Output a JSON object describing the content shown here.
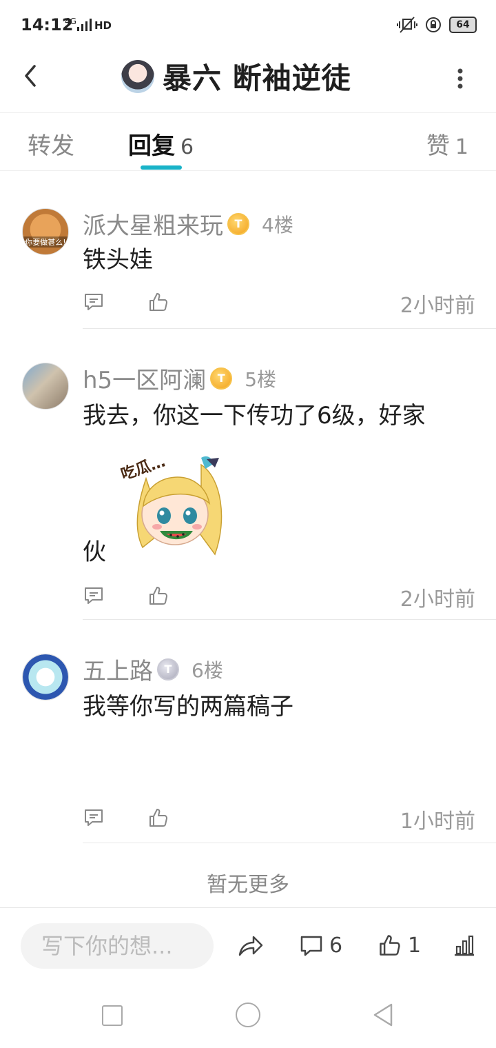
{
  "status_bar": {
    "time": "14:12",
    "network": "4G",
    "hd": "HD",
    "battery": "64"
  },
  "header": {
    "title": "暴六 断袖逆徒"
  },
  "tabs": [
    {
      "label": "转发",
      "count": ""
    },
    {
      "label": "回复",
      "count": "6"
    },
    {
      "label": "赞",
      "count": "1"
    }
  ],
  "comments": [
    {
      "name": "派大星粗来玩",
      "floor": "4楼",
      "avatar_caption": "你要做甚么!",
      "badge": "T",
      "text": "铁头娃",
      "time": "2小时前"
    },
    {
      "name": "h5一区阿澜",
      "floor": "5楼",
      "badge": "T",
      "text_line1": "我去，你这一下传功了6级，好家",
      "text_line2": "伙",
      "sticker_text": "吃瓜…",
      "time": "2小时前"
    },
    {
      "name": "五上路",
      "floor": "6楼",
      "badge": "T",
      "text": "我等你写的两篇稿子",
      "time": "1小时前"
    }
  ],
  "no_more": "暂无更多",
  "bottom": {
    "input_placeholder": "写下你的想...",
    "comment_count": "6",
    "like_count": "1"
  },
  "icons": [
    "back-icon",
    "more-icon",
    "comment-icon",
    "like-icon",
    "share-icon",
    "stats-icon"
  ],
  "colors": {
    "accent": "#19b3c8",
    "muted_text": "#8a8a8a"
  }
}
